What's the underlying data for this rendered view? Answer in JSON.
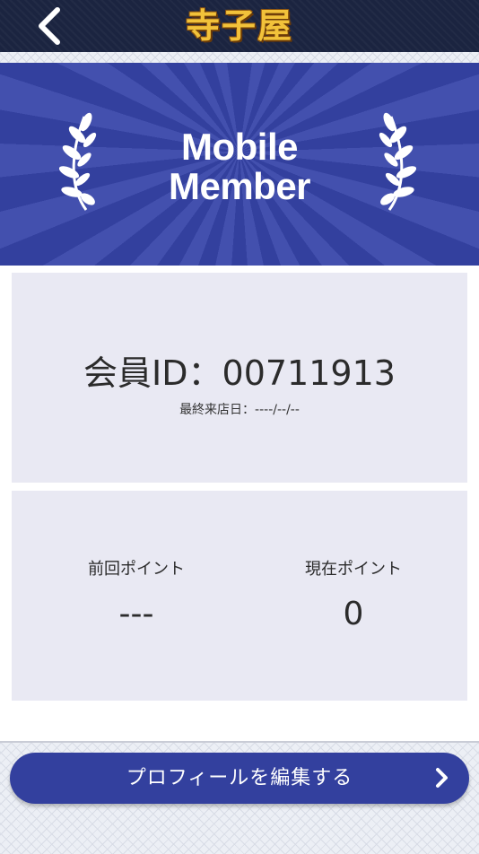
{
  "header": {
    "logo_text": "寺子屋",
    "back_icon": "chevron-left-icon"
  },
  "banner": {
    "title_line1": "Mobile",
    "title_line2": "Member",
    "left_icon": "laurel-left-icon",
    "right_icon": "laurel-right-icon"
  },
  "member": {
    "id_text": "会員ID：00711913",
    "last_visit": "最終来店日：----/--/--"
  },
  "points": {
    "previous_label": "前回ポイント",
    "previous_value": "---",
    "current_label": "現在ポイント",
    "current_value": "0"
  },
  "footer": {
    "edit_label": "プロフィールを編集する",
    "edit_icon": "chevron-right-icon"
  },
  "colors": {
    "header_bg": "#1b2440",
    "banner_blue": "#33409e",
    "logo_gold": "#f2c23a",
    "card_bg": "#e9e9f3"
  }
}
